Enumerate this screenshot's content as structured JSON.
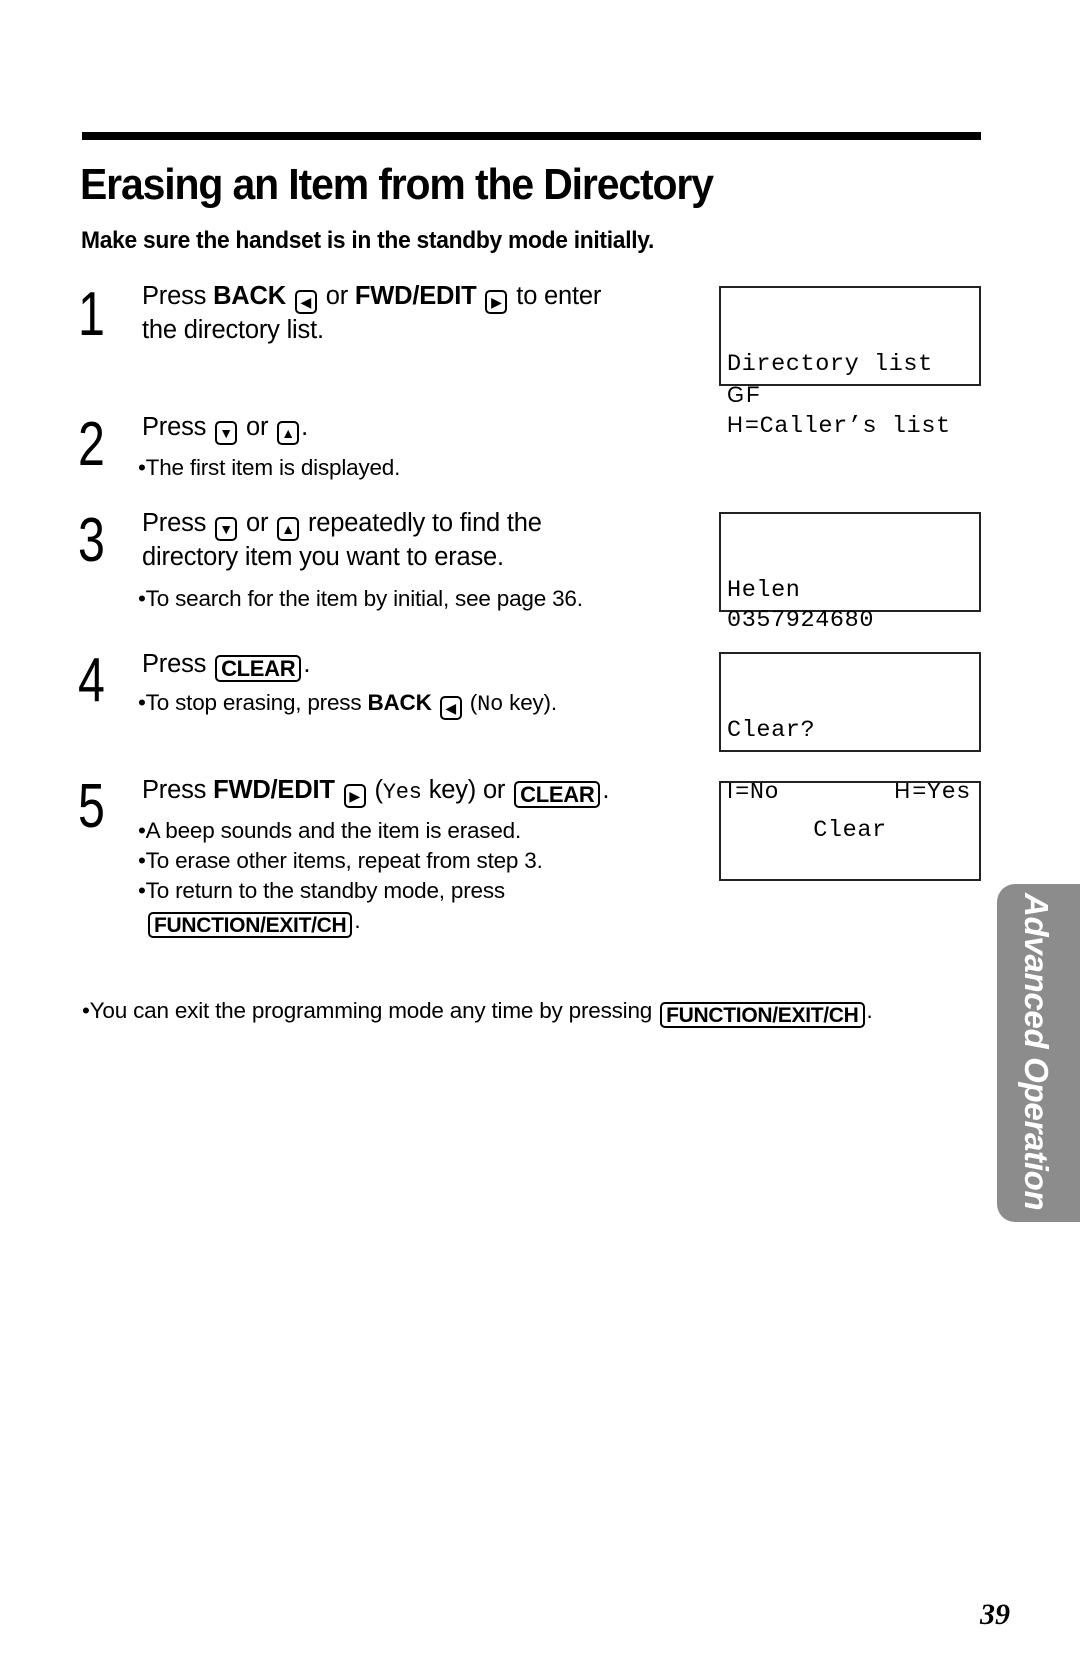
{
  "header": {
    "title": "Erasing an Item from the Directory",
    "subtitle": "Make sure the handset is in the standby mode initially."
  },
  "steps": [
    {
      "number": "1",
      "text_parts": [
        "Press ",
        "BACK",
        " ",
        " or ",
        "FWD/EDIT",
        " ",
        " to enter"
      ],
      "line2": "the directory list.",
      "keys": {
        "back_icon": "◀",
        "fwd_icon": "▶"
      }
    },
    {
      "number": "2",
      "press": "Press ",
      "or": " or ",
      "end": ".",
      "keys": {
        "down_icon": "▼",
        "up_icon": "▲"
      },
      "notes": [
        "•The first item is displayed."
      ]
    },
    {
      "number": "3",
      "press": "Press ",
      "or": " or ",
      "rest": " repeatedly to find the",
      "line2": "directory item you want to erase.",
      "keys": {
        "down_icon": "▼",
        "up_icon": "▲"
      },
      "notes": [
        "•To search for the item by initial, see page 36."
      ]
    },
    {
      "number": "4",
      "press": "Press ",
      "key": "CLEAR",
      "end": ".",
      "note_parts": [
        "•To stop erasing, press ",
        "BACK",
        " (",
        "No",
        " key)."
      ],
      "keys": {
        "back_icon": "◀"
      }
    },
    {
      "number": "5",
      "press": "Press ",
      "bold": "FWD/EDIT",
      "paren_open": " (",
      "mono": "Yes",
      "paren_rest": " key) or ",
      "key": "CLEAR",
      "end": ".",
      "keys": {
        "fwd_icon": "▶"
      },
      "notes": [
        "•A beep sounds and the item is erased.",
        "•To erase other items, repeat from step 3.",
        "•To return to the standby mode, press"
      ],
      "final_key": "FUNCTION/EXIT/CH",
      "final_end": "."
    }
  ],
  "displays": [
    {
      "lines": [
        "Directory list",
        "GF",
        "=Caller’s list"
      ],
      "line3_symbol": "H"
    },
    {
      "lines": [
        "Helen",
        "0357924680",
        ""
      ]
    },
    {
      "line1": "Clear?",
      "left_symbol": "I",
      "left": "=No",
      "right_symbol": "H",
      "right": "=Yes"
    },
    {
      "center": "Clear"
    }
  ],
  "footer_note": {
    "text": "•You can exit the programming mode any time by pressing ",
    "key": "FUNCTION/EXIT/CH",
    "end": "."
  },
  "side_tab": {
    "label": "Advanced Operation",
    "color": "#8c8c8c"
  },
  "page_number": "39"
}
